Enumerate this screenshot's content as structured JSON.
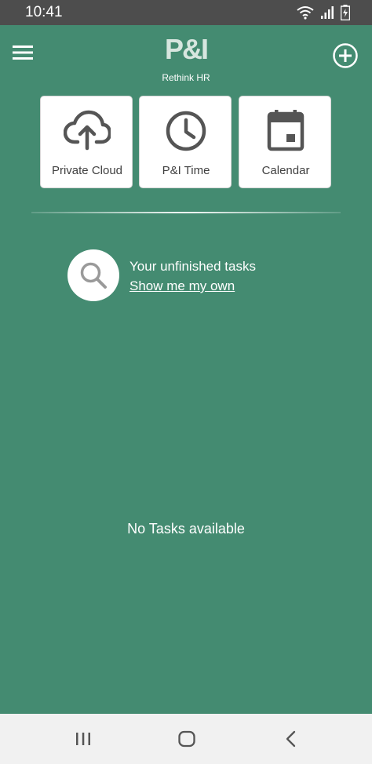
{
  "status_bar": {
    "time": "10:41",
    "icons": [
      "wifi-icon",
      "signal-icon",
      "battery-charging-icon"
    ]
  },
  "header": {
    "menu_icon": "hamburger-menu-icon",
    "logo_text": "P&I",
    "tagline": "Rethink HR",
    "add_icon": "add-circle-icon"
  },
  "tiles": [
    {
      "label": "Private Cloud",
      "icon": "cloud-upload-icon"
    },
    {
      "label": "P&I Time",
      "icon": "clock-icon"
    },
    {
      "label": "Calendar",
      "icon": "calendar-icon"
    }
  ],
  "task_filter": {
    "title": "Your unfinished tasks",
    "link": "Show me my own",
    "icon": "search-icon"
  },
  "empty_state": "No Tasks available",
  "nav_bar": {
    "buttons": [
      "recents-icon",
      "home-icon",
      "back-icon"
    ]
  },
  "colors": {
    "background": "#448b71",
    "status_bar": "#4d4d4d",
    "tile_background": "#ffffff",
    "icon_gray": "#555555",
    "nav_bar": "#f1f1f1"
  }
}
